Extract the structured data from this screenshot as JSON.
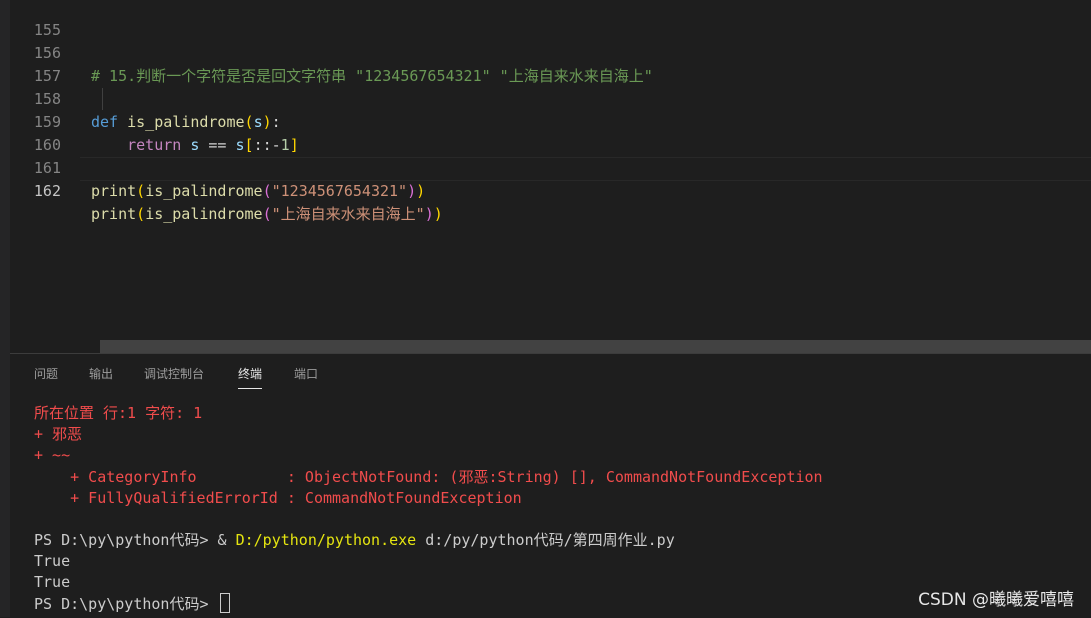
{
  "editor": {
    "lines": [
      {
        "no": "155",
        "segs": []
      },
      {
        "no": "156",
        "segs": [
          {
            "t": "# 15.判断一个字符是否是回文字符串 \"1234567654321\" \"上海自来水来自海上\"",
            "c": "c-comment"
          }
        ]
      },
      {
        "no": "157",
        "segs": []
      },
      {
        "no": "158",
        "segs": [
          {
            "t": "def",
            "c": "c-kw"
          },
          {
            "t": " ",
            "c": "c-op"
          },
          {
            "t": "is_palindrome",
            "c": "c-fn"
          },
          {
            "t": "(",
            "c": "c-b1"
          },
          {
            "t": "s",
            "c": "c-var"
          },
          {
            "t": ")",
            "c": "c-b1"
          },
          {
            "t": ":",
            "c": "c-op"
          }
        ]
      },
      {
        "no": "159",
        "segs": [
          {
            "t": "    ",
            "c": "c-op"
          },
          {
            "t": "return",
            "c": "c-ctrl"
          },
          {
            "t": " ",
            "c": "c-op"
          },
          {
            "t": "s",
            "c": "c-var"
          },
          {
            "t": " == ",
            "c": "c-op"
          },
          {
            "t": "s",
            "c": "c-var"
          },
          {
            "t": "[",
            "c": "c-b1"
          },
          {
            "t": "::-",
            "c": "c-op"
          },
          {
            "t": "1",
            "c": "c-num"
          },
          {
            "t": "]",
            "c": "c-b1"
          }
        ]
      },
      {
        "no": "160",
        "segs": []
      },
      {
        "no": "161",
        "segs": [
          {
            "t": "print",
            "c": "c-fn"
          },
          {
            "t": "(",
            "c": "c-b1"
          },
          {
            "t": "is_palindrome",
            "c": "c-fn"
          },
          {
            "t": "(",
            "c": "c-b2"
          },
          {
            "t": "\"1234567654321\"",
            "c": "c-str"
          },
          {
            "t": ")",
            "c": "c-b2"
          },
          {
            "t": ")",
            "c": "c-b1"
          }
        ]
      },
      {
        "no": "162",
        "segs": [
          {
            "t": "print",
            "c": "c-fn"
          },
          {
            "t": "(",
            "c": "c-b1"
          },
          {
            "t": "is_palindrome",
            "c": "c-fn"
          },
          {
            "t": "(",
            "c": "c-b2"
          },
          {
            "t": "\"上海自来水来自海上\"",
            "c": "c-str"
          },
          {
            "t": ")",
            "c": "c-b2"
          },
          {
            "t": ")",
            "c": "c-b1"
          }
        ],
        "current": true
      }
    ]
  },
  "panel": {
    "tabs": [
      {
        "label": "问题",
        "active": false
      },
      {
        "label": "输出",
        "active": false
      },
      {
        "label": "调试控制台",
        "active": false
      },
      {
        "label": "终端",
        "active": true
      },
      {
        "label": "端口",
        "active": false
      }
    ]
  },
  "terminal": {
    "lines": [
      {
        "segs": [
          {
            "t": "所在位置 行:1 字符: 1",
            "c": "t-err"
          }
        ]
      },
      {
        "segs": [
          {
            "t": "+ 邪恶",
            "c": "t-err"
          }
        ]
      },
      {
        "segs": [
          {
            "t": "+ ~~",
            "c": "t-err"
          }
        ]
      },
      {
        "segs": [
          {
            "t": "    + CategoryInfo          : ObjectNotFound: (邪恶:String) [], CommandNotFoundException",
            "c": "t-err"
          }
        ]
      },
      {
        "segs": [
          {
            "t": "    + FullyQualifiedErrorId : CommandNotFoundException",
            "c": "t-err"
          }
        ]
      },
      {
        "segs": []
      },
      {
        "segs": [
          {
            "t": "PS D:\\py\\python代码> & ",
            "c": ""
          },
          {
            "t": "D:/python/python.exe",
            "c": "t-yel"
          },
          {
            "t": " d:/py/python代码/第四周作业.py",
            "c": ""
          }
        ]
      },
      {
        "segs": [
          {
            "t": "True",
            "c": ""
          }
        ]
      },
      {
        "segs": [
          {
            "t": "True",
            "c": ""
          }
        ]
      },
      {
        "segs": [
          {
            "t": "PS D:\\py\\python代码> ",
            "c": ""
          }
        ],
        "cursor": true
      }
    ]
  },
  "watermark": "CSDN @曦曦爱嘻嘻"
}
